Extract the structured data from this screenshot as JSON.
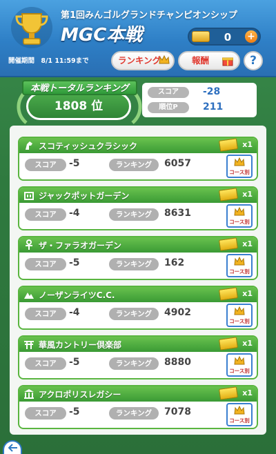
{
  "header": {
    "event_title": "第1回みんゴルグランドチャンピオンシップ",
    "main_title": "MGC本戦",
    "period_label": "開催期間",
    "period_value": "8/1 11:59まで",
    "coin_value": "0",
    "ranking_button": "ランキング",
    "reward_button": "報酬",
    "help_button": "?"
  },
  "total": {
    "tag_label": "本戦トータルランキング",
    "rank_text": "1808 位",
    "score_label": "スコア",
    "score_value": "-28",
    "points_label": "順位P",
    "points_value": "211"
  },
  "common": {
    "score_label": "スコア",
    "rank_label": "ランキング",
    "course_button": "コース別"
  },
  "courses": [
    {
      "name": "スコティッシュクラシック",
      "score": "-5",
      "rank": "6057",
      "tickets": "x1",
      "icon": "horse-icon"
    },
    {
      "name": "ジャックポットガーデン",
      "score": "-4",
      "rank": "8631",
      "tickets": "x1",
      "icon": "slot-icon"
    },
    {
      "name": "ザ・ファラオガーデン",
      "score": "-5",
      "rank": "162",
      "tickets": "x1",
      "icon": "ankh-icon"
    },
    {
      "name": "ノーザンライツC.C.",
      "score": "-4",
      "rank": "4902",
      "tickets": "x1",
      "icon": "mountain-icon"
    },
    {
      "name": "華風カントリー倶楽部",
      "score": "-5",
      "rank": "8880",
      "tickets": "x1",
      "icon": "torii-icon"
    },
    {
      "name": "アクロポリスレガシー",
      "score": "-5",
      "rank": "7078",
      "tickets": "x1",
      "icon": "temple-icon"
    }
  ],
  "colors": {
    "header_blue": "#2e7fc6",
    "card_green": "#59b53f",
    "accent_red": "#e0392f",
    "score_blue": "#2d6fbf"
  }
}
